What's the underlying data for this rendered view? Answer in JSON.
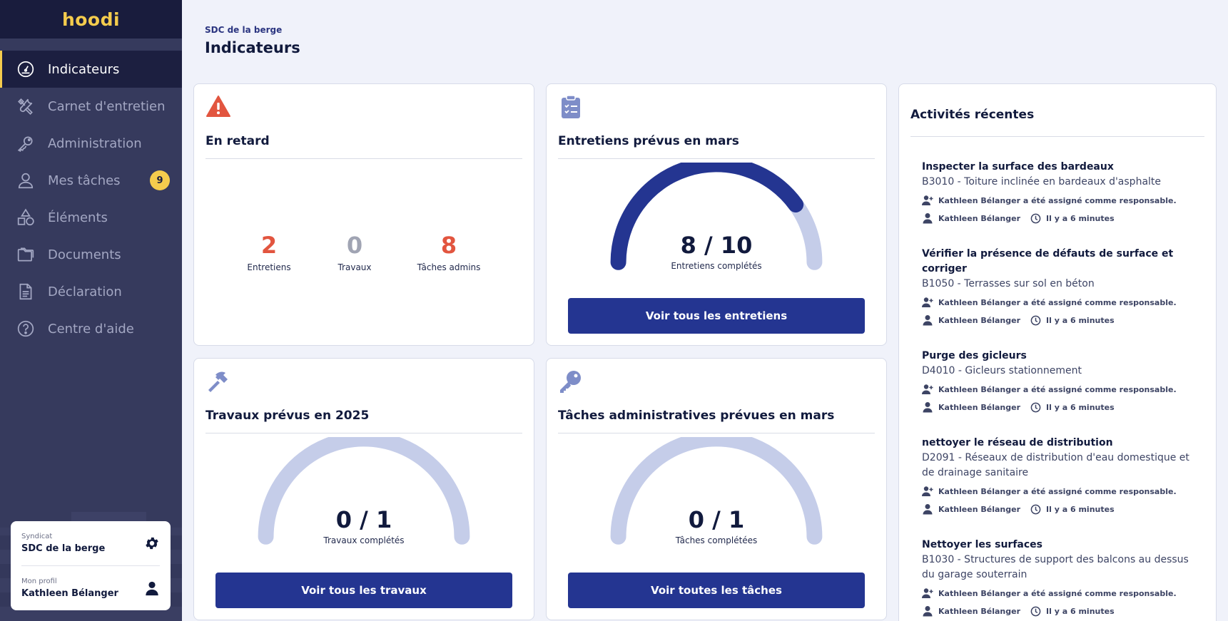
{
  "brand": "hoodi",
  "sidebar": {
    "items": [
      {
        "label": "Indicateurs",
        "icon": "gauge-icon",
        "active": true
      },
      {
        "label": "Carnet d'entretien",
        "icon": "tools-icon"
      },
      {
        "label": "Administration",
        "icon": "key-icon"
      },
      {
        "label": "Mes tâches",
        "icon": "user-icon",
        "badge": "9"
      },
      {
        "label": "Éléments",
        "icon": "shapes-icon"
      },
      {
        "label": "Documents",
        "icon": "folder-icon"
      },
      {
        "label": "Déclaration",
        "icon": "document-icon"
      },
      {
        "label": "Centre d'aide",
        "icon": "help-icon"
      }
    ],
    "profile_card": {
      "syndicat_label": "Syndicat",
      "syndicat_value": "SDC de la berge",
      "profil_label": "Mon profil",
      "profil_value": "Kathleen Bélanger"
    }
  },
  "header": {
    "breadcrumb": "SDC de la berge",
    "title": "Indicateurs"
  },
  "cards": {
    "late": {
      "title": "En retard",
      "stats": [
        {
          "value": "2",
          "label": "Entretiens",
          "color": "#e2553f"
        },
        {
          "value": "0",
          "label": "Travaux",
          "color": "#a0a4b3"
        },
        {
          "value": "8",
          "label": "Tâches admins",
          "color": "#e2553f"
        }
      ]
    },
    "maintenance": {
      "title": "Entretiens prévus en mars",
      "gauge_text": "8 / 10",
      "done": 8,
      "total": 10,
      "subtitle": "Entretiens complétés",
      "button": "Voir tous les entretiens"
    },
    "works": {
      "title": "Travaux prévus en 2025",
      "gauge_text": "0 / 1",
      "done": 0,
      "total": 1,
      "subtitle": "Travaux complétés",
      "button": "Voir tous les travaux"
    },
    "admin": {
      "title": "Tâches administratives prévues en mars",
      "gauge_text": "0 / 1",
      "done": 0,
      "total": 1,
      "subtitle": "Tâches complétées",
      "button": "Voir toutes les tâches"
    }
  },
  "activity": {
    "title": "Activités récentes",
    "items": [
      {
        "name": "Inspecter la surface des bardeaux",
        "desc": "B3010 - Toiture inclinée en bardeaux d'asphalte",
        "assign": "Kathleen Bélanger a été assigné comme responsable.",
        "user": "Kathleen Bélanger",
        "time": "Il y a 6 minutes"
      },
      {
        "name": "Vérifier la présence de défauts de surface et corriger",
        "desc": "B1050 - Terrasses sur sol en béton",
        "assign": "Kathleen Bélanger a été assigné comme responsable.",
        "user": "Kathleen Bélanger",
        "time": "Il y a 6 minutes"
      },
      {
        "name": "Purge des gicleurs",
        "desc": "D4010 - Gicleurs stationnement",
        "assign": "Kathleen Bélanger a été assigné comme responsable.",
        "user": "Kathleen Bélanger",
        "time": "Il y a 6 minutes"
      },
      {
        "name": "nettoyer le réseau de distribution",
        "desc": "D2091 - Réseaux de distribution d'eau domestique et de drainage sanitaire",
        "assign": "Kathleen Bélanger a été assigné comme responsable.",
        "user": "Kathleen Bélanger",
        "time": "Il y a 6 minutes"
      },
      {
        "name": "Nettoyer les surfaces",
        "desc": "B1030 - Structures de support des balcons au dessus du garage souterrain",
        "assign": "Kathleen Bélanger a été assigné comme responsable.",
        "user": "Kathleen Bélanger",
        "time": "Il y a 6 minutes"
      }
    ]
  },
  "colors": {
    "accent": "#243591",
    "gauge_track": "#c5cde9",
    "warning": "#e2553f",
    "brand_yellow": "#f5cc4d"
  }
}
